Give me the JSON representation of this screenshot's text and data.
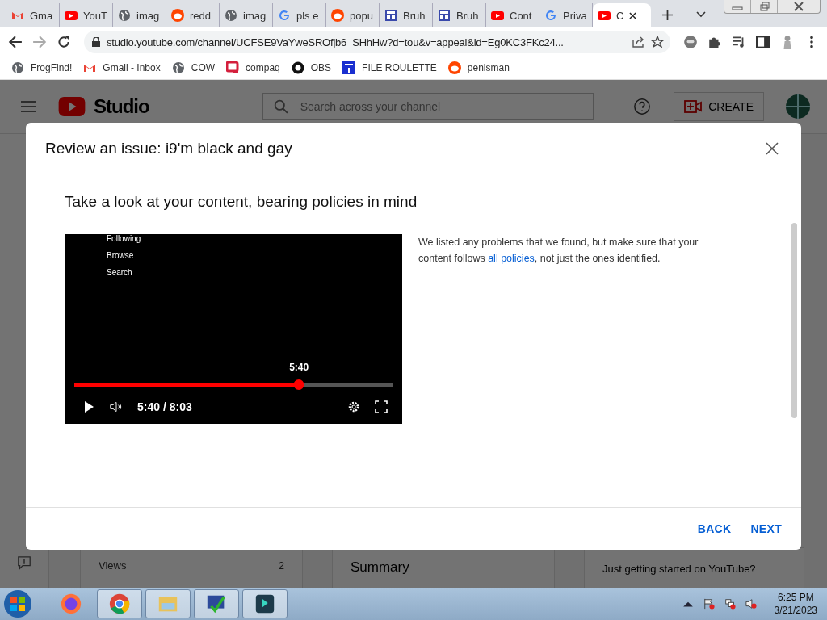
{
  "browser": {
    "tabs": [
      {
        "title": "Gma",
        "kind": "gmail",
        "selected": false
      },
      {
        "title": "YouT",
        "kind": "youtube",
        "selected": false
      },
      {
        "title": "imag",
        "kind": "globe",
        "selected": false
      },
      {
        "title": "redd",
        "kind": "reddit",
        "selected": false
      },
      {
        "title": "imag",
        "kind": "globe",
        "selected": false
      },
      {
        "title": "pls e",
        "kind": "google",
        "selected": false
      },
      {
        "title": "popu",
        "kind": "reddit",
        "selected": false
      },
      {
        "title": "Bruh",
        "kind": "layout",
        "selected": false
      },
      {
        "title": "Bruh",
        "kind": "layout",
        "selected": false
      },
      {
        "title": "Cont",
        "kind": "youtube",
        "selected": false
      },
      {
        "title": "Priva",
        "kind": "google",
        "selected": false
      },
      {
        "title": "C",
        "kind": "youtube",
        "selected": true
      }
    ],
    "url": "studio.youtube.com/channel/UCFSE9VaYweSROfjb6_SHhHw?d=tou&v=appeal&id=Eg0KC3FKc24...",
    "bookmarks": [
      {
        "title": "FrogFind!",
        "kind": "globe"
      },
      {
        "title": "Gmail - Inbox",
        "kind": "gmail"
      },
      {
        "title": "COW",
        "kind": "globe"
      },
      {
        "title": "compaq",
        "kind": "compaq"
      },
      {
        "title": "OBS",
        "kind": "github"
      },
      {
        "title": "FILE ROULETTE",
        "kind": "mft"
      },
      {
        "title": "penisman",
        "kind": "reddit"
      }
    ]
  },
  "studio": {
    "logo": "Studio",
    "search": {
      "placeholder": "Search across your channel"
    },
    "create_button": "CREATE",
    "views_label": "Views",
    "views_value": "2",
    "summary_title": "Summary",
    "tip": "Just getting started on YouTube?"
  },
  "dialog": {
    "title": "Review an issue: i9'm black and gay",
    "heading": "Take a look at your content, bearing policies in mind",
    "video": {
      "menu": [
        "Following",
        "Browse",
        "Search"
      ],
      "hover_time": "5:40",
      "level": 0.706,
      "time": "5:40 / 8:03"
    },
    "description": {
      "before": "We listed any problems that we found, but make sure that your content follows ",
      "link": "all policies",
      "after": ", not just the ones identified."
    },
    "buttons": [
      "BACK",
      "NEXT"
    ]
  },
  "taskbar": {
    "apps": [
      {
        "kind": "firefox",
        "selected": false
      },
      {
        "kind": "chrome",
        "selected": true
      },
      {
        "kind": "explorer",
        "selected": true
      },
      {
        "kind": "checker",
        "selected": true
      },
      {
        "kind": "editor",
        "selected": true
      }
    ],
    "time": "6:25 PM",
    "date": "3/21/2023"
  }
}
